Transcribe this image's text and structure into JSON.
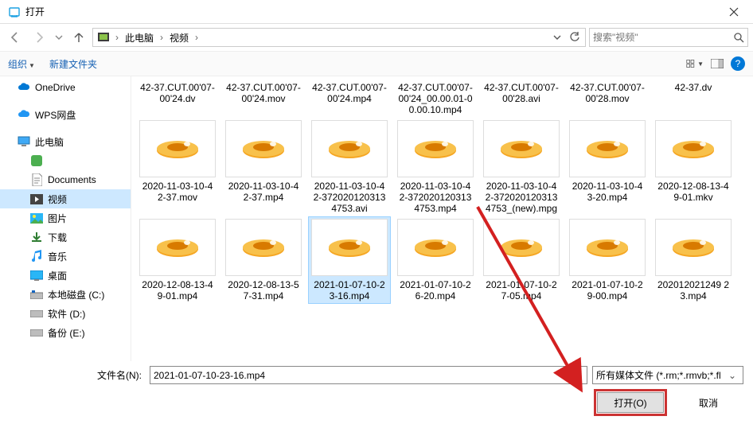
{
  "title": "打开",
  "nav": {
    "back_disabled": true
  },
  "breadcrumb": {
    "root": "此电脑",
    "folder": "视频"
  },
  "search": {
    "placeholder": "搜索\"视频\""
  },
  "toolbar": {
    "organize": "组织",
    "newfolder": "新建文件夹"
  },
  "sidebar": {
    "onedrive": "OneDrive",
    "wps": "WPS网盘",
    "thispc": "此电脑",
    "documents": "Documents",
    "videos": "视频",
    "pictures": "图片",
    "downloads": "下载",
    "music": "音乐",
    "desktop": "桌面",
    "localc": "本地磁盘 (C:)",
    "soft": "软件 (D:)",
    "backup": "备份 (E:)"
  },
  "files_row0": [
    "42-37.CUT.00'07-00'24.dv",
    "42-37.CUT.00'07-00'24.mov",
    "42-37.CUT.00'07-00'24.mp4",
    "42-37.CUT.00'07-00'24_00.00.01-00.00.10.mp4",
    "42-37.CUT.00'07-00'28.avi",
    "42-37.CUT.00'07-00'28.mov",
    "42-37.dv"
  ],
  "files_row1": [
    "2020-11-03-10-42-37.mov",
    "2020-11-03-10-42-37.mp4",
    "2020-11-03-10-42-3720201203134753.avi",
    "2020-11-03-10-42-3720201203134753.mp4",
    "2020-11-03-10-42-3720201203134753_(new).mpg",
    "2020-11-03-10-43-20.mp4",
    "2020-12-08-13-49-01.mkv"
  ],
  "files_row2": [
    "2020-12-08-13-49-01.mp4",
    "2020-12-08-13-57-31.mp4",
    "2021-01-07-10-23-16.mp4",
    "2021-01-07-10-26-20.mp4",
    "2021-01-07-10-27-05.mp4",
    "2021-01-07-10-29-00.mp4",
    "202012021249 23.mp4"
  ],
  "selected_index": 2,
  "filename_label": "文件名(N):",
  "filename_value": "2021-01-07-10-23-16.mp4",
  "filetype": "所有媒体文件 (*.rm;*.rmvb;*.fl",
  "open_btn": "打开(O)",
  "cancel_btn": "取消"
}
